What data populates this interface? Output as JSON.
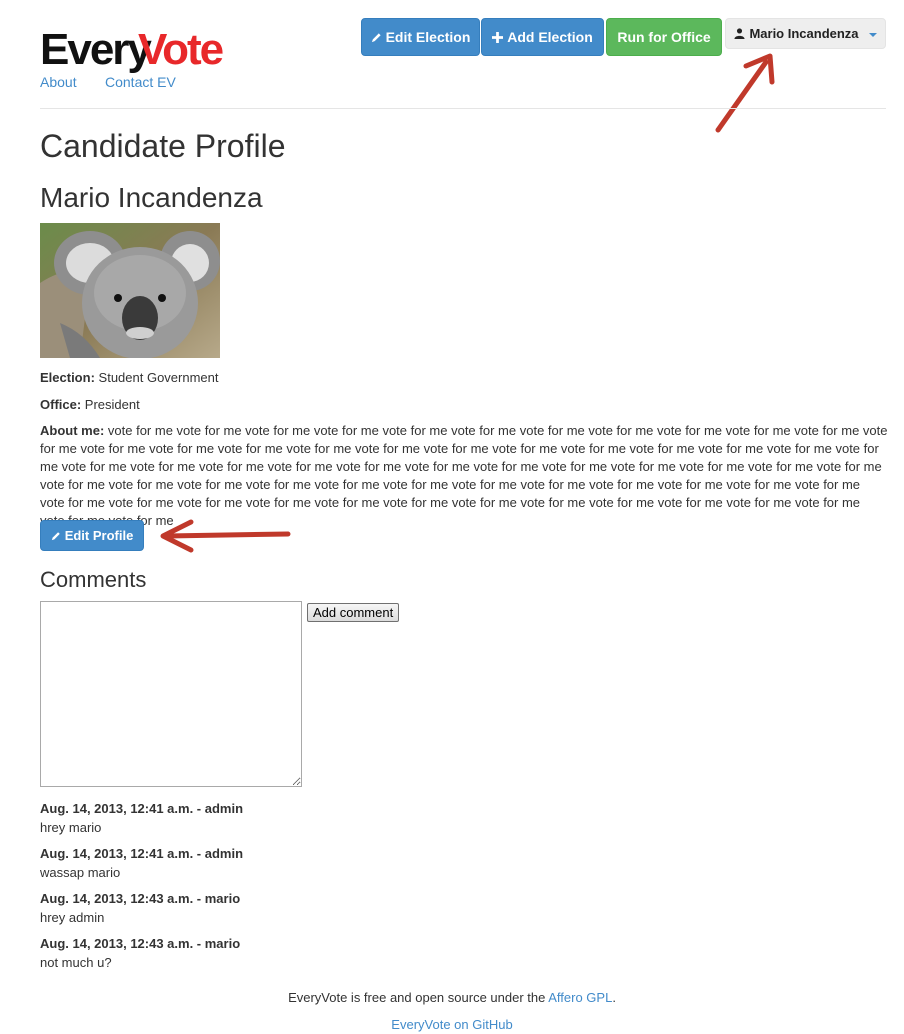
{
  "brand": {
    "every": "Every",
    "vote": "Vote"
  },
  "nav": {
    "about": "About",
    "contact": "Contact EV",
    "edit_election": "Edit Election",
    "add_election": "Add Election",
    "run_for_office": "Run for Office",
    "user_menu": "Mario Incandenza"
  },
  "page": {
    "title": "Candidate Profile",
    "candidate_name": "Mario Incandenza",
    "election_label": "Election:",
    "election_value": "Student Government",
    "office_label": "Office:",
    "office_value": "President",
    "about_label": "About me:",
    "about_value": "vote for me vote for me vote for me vote for me vote for me vote for me vote for me vote for me vote for me vote for me vote for me vote for me vote for me vote for me vote for me vote for me vote for me vote for me vote for me vote for me vote for me vote for me vote for me vote for me vote for me vote for me vote for me vote for me vote for me vote for me vote for me vote for me vote for me vote for me vote for me vote for me vote for me vote for me vote for me vote for me vote for me vote for me vote for me vote for me vote for me vote for me vote for me vote for me vote for me vote for me vote for me vote for me vote for me vote for me vote for me vote for me vote for me vote for me vote for me vote for me vote for me vote for me",
    "edit_profile": "Edit Profile"
  },
  "comments": {
    "title": "Comments",
    "add_button": "Add comment",
    "items": [
      {
        "meta": "Aug. 14, 2013, 12:41 a.m. - admin",
        "text": "hrey mario"
      },
      {
        "meta": "Aug. 14, 2013, 12:41 a.m. - admin",
        "text": "wassap mario"
      },
      {
        "meta": "Aug. 14, 2013, 12:43 a.m. - mario",
        "text": "hrey admin"
      },
      {
        "meta": "Aug. 14, 2013, 12:43 a.m. - mario",
        "text": "not much u?"
      }
    ]
  },
  "footer": {
    "line1_prefix": "EveryVote is free and open source under the ",
    "line1_link": "Affero GPL",
    "line1_suffix": ".",
    "github_link": "EveryVote on GitHub"
  },
  "icons": {
    "pencil": "pencil-icon",
    "plus": "plus-icon",
    "user": "user-icon"
  },
  "colors": {
    "primary": "#428bca",
    "success": "#5cb85c",
    "brand_red": "#e8282a",
    "annotation_arrow": "#c0392b"
  }
}
